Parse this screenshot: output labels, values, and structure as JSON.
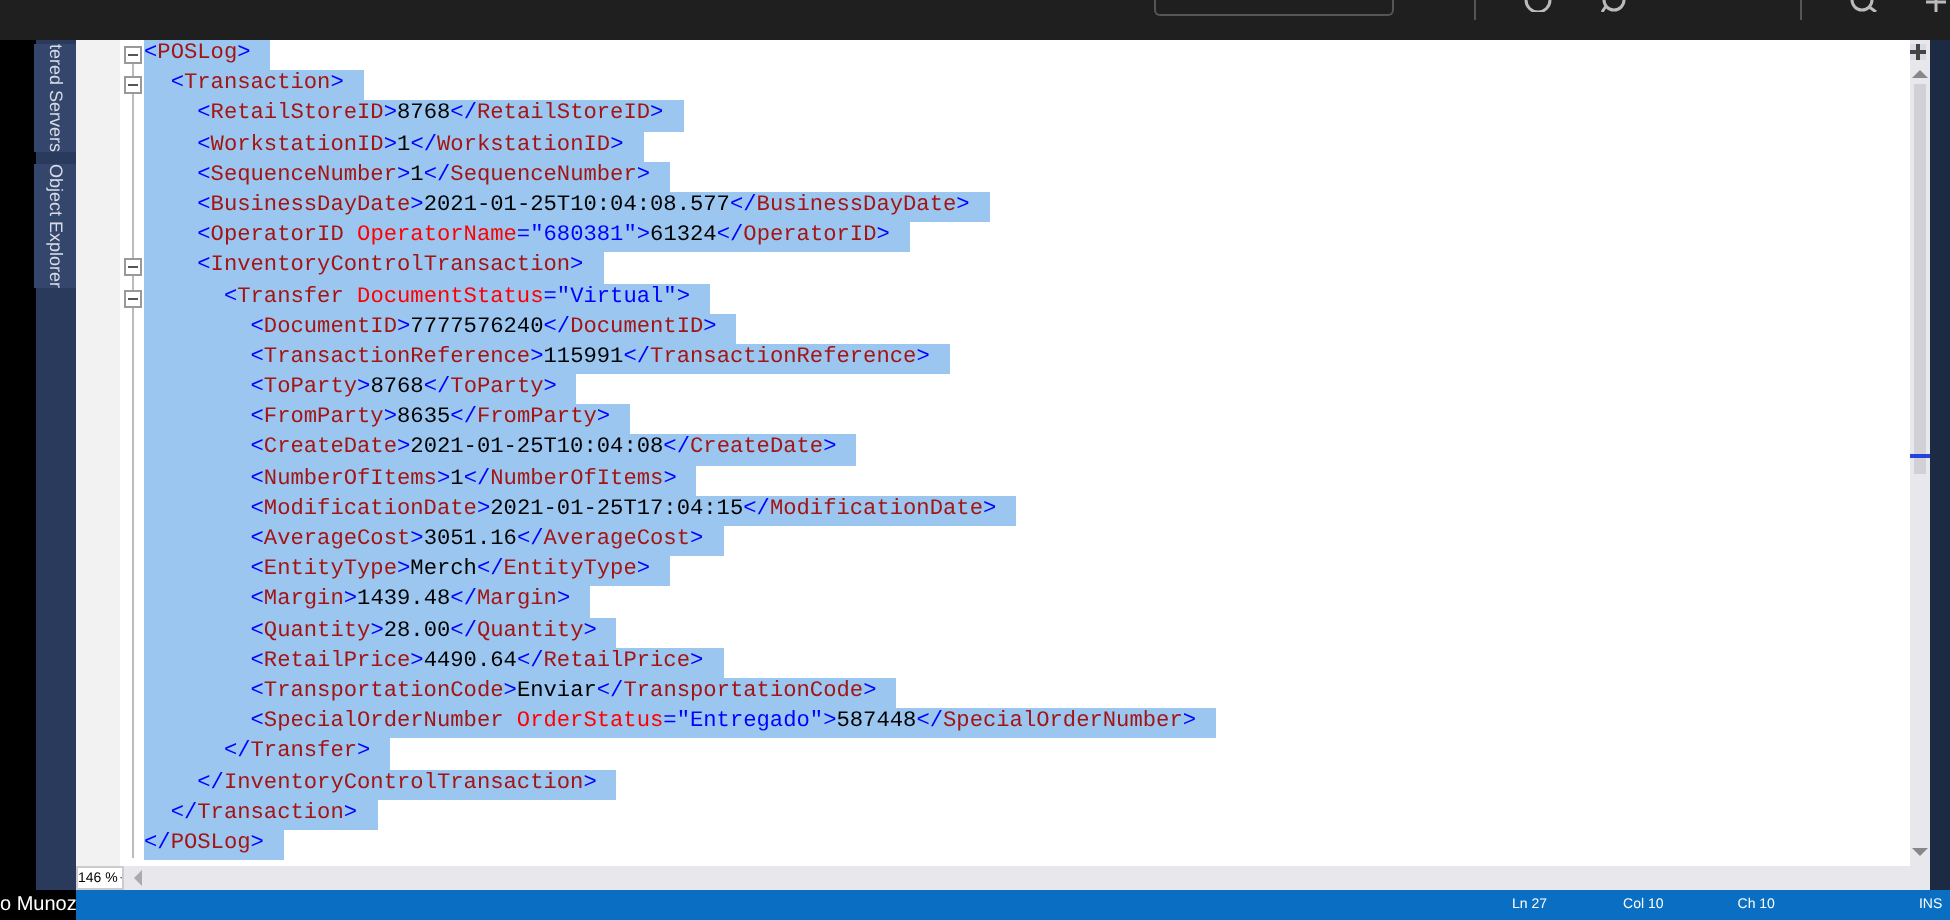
{
  "sidebar": {
    "tabs": [
      {
        "label": "tered Servers"
      },
      {
        "label": "Object Explorer"
      }
    ]
  },
  "editor": {
    "lines": [
      {
        "expanded": true,
        "selected": true,
        "tokens": [
          {
            "kind": "punct",
            "text": "<"
          },
          {
            "kind": "name",
            "text": "POSLog"
          },
          {
            "kind": "punct",
            "text": ">"
          }
        ]
      },
      {
        "expanded": true,
        "selected": true,
        "tokens": [
          {
            "kind": "punct",
            "text": "  <"
          },
          {
            "kind": "name",
            "text": "Transaction"
          },
          {
            "kind": "punct",
            "text": ">"
          }
        ]
      },
      {
        "selected": true,
        "tokens": [
          {
            "kind": "punct",
            "text": "    <"
          },
          {
            "kind": "name",
            "text": "RetailStoreID"
          },
          {
            "kind": "punct",
            "text": ">"
          },
          {
            "kind": "text",
            "text": "8768"
          },
          {
            "kind": "punct",
            "text": "</"
          },
          {
            "kind": "name",
            "text": "RetailStoreID"
          },
          {
            "kind": "punct",
            "text": ">"
          }
        ]
      },
      {
        "selected": true,
        "tokens": [
          {
            "kind": "punct",
            "text": "    <"
          },
          {
            "kind": "name",
            "text": "WorkstationID"
          },
          {
            "kind": "punct",
            "text": ">"
          },
          {
            "kind": "text",
            "text": "1"
          },
          {
            "kind": "punct",
            "text": "</"
          },
          {
            "kind": "name",
            "text": "WorkstationID"
          },
          {
            "kind": "punct",
            "text": ">"
          }
        ]
      },
      {
        "selected": true,
        "tokens": [
          {
            "kind": "punct",
            "text": "    <"
          },
          {
            "kind": "name",
            "text": "SequenceNumber"
          },
          {
            "kind": "punct",
            "text": ">"
          },
          {
            "kind": "text",
            "text": "1"
          },
          {
            "kind": "punct",
            "text": "</"
          },
          {
            "kind": "name",
            "text": "SequenceNumber"
          },
          {
            "kind": "punct",
            "text": ">"
          }
        ]
      },
      {
        "selected": true,
        "tokens": [
          {
            "kind": "punct",
            "text": "    <"
          },
          {
            "kind": "name",
            "text": "BusinessDayDate"
          },
          {
            "kind": "punct",
            "text": ">"
          },
          {
            "kind": "text",
            "text": "2021-01-25T10:04:08.577"
          },
          {
            "kind": "punct",
            "text": "</"
          },
          {
            "kind": "name",
            "text": "BusinessDayDate"
          },
          {
            "kind": "punct",
            "text": ">"
          }
        ]
      },
      {
        "selected": true,
        "tokens": [
          {
            "kind": "punct",
            "text": "    <"
          },
          {
            "kind": "name",
            "text": "OperatorID"
          },
          {
            "kind": "attr",
            "text": " OperatorName"
          },
          {
            "kind": "punct",
            "text": "="
          },
          {
            "kind": "value",
            "text": "\"680381\""
          },
          {
            "kind": "punct",
            "text": ">"
          },
          {
            "kind": "text",
            "text": "61324"
          },
          {
            "kind": "punct",
            "text": "</"
          },
          {
            "kind": "name",
            "text": "OperatorID"
          },
          {
            "kind": "punct",
            "text": ">"
          }
        ]
      },
      {
        "expanded": true,
        "selected": true,
        "tokens": [
          {
            "kind": "punct",
            "text": "    <"
          },
          {
            "kind": "name",
            "text": "InventoryControlTransaction"
          },
          {
            "kind": "punct",
            "text": ">"
          }
        ]
      },
      {
        "expanded": true,
        "selected": true,
        "tokens": [
          {
            "kind": "punct",
            "text": "      <"
          },
          {
            "kind": "name",
            "text": "Transfer"
          },
          {
            "kind": "attr",
            "text": " DocumentStatus"
          },
          {
            "kind": "punct",
            "text": "="
          },
          {
            "kind": "value",
            "text": "\"Virtual\""
          },
          {
            "kind": "punct",
            "text": ">"
          }
        ]
      },
      {
        "selected": true,
        "tokens": [
          {
            "kind": "punct",
            "text": "        <"
          },
          {
            "kind": "name",
            "text": "DocumentID"
          },
          {
            "kind": "punct",
            "text": ">"
          },
          {
            "kind": "text",
            "text": "7777576240"
          },
          {
            "kind": "punct",
            "text": "</"
          },
          {
            "kind": "name",
            "text": "DocumentID"
          },
          {
            "kind": "punct",
            "text": ">"
          }
        ]
      },
      {
        "selected": true,
        "tokens": [
          {
            "kind": "punct",
            "text": "        <"
          },
          {
            "kind": "name",
            "text": "TransactionReference"
          },
          {
            "kind": "punct",
            "text": ">"
          },
          {
            "kind": "text",
            "text": "115991"
          },
          {
            "kind": "punct",
            "text": "</"
          },
          {
            "kind": "name",
            "text": "TransactionReference"
          },
          {
            "kind": "punct",
            "text": ">"
          }
        ]
      },
      {
        "selected": true,
        "tokens": [
          {
            "kind": "punct",
            "text": "        <"
          },
          {
            "kind": "name",
            "text": "ToParty"
          },
          {
            "kind": "punct",
            "text": ">"
          },
          {
            "kind": "text",
            "text": "8768"
          },
          {
            "kind": "punct",
            "text": "</"
          },
          {
            "kind": "name",
            "text": "ToParty"
          },
          {
            "kind": "punct",
            "text": ">"
          }
        ]
      },
      {
        "selected": true,
        "tokens": [
          {
            "kind": "punct",
            "text": "        <"
          },
          {
            "kind": "name",
            "text": "FromParty"
          },
          {
            "kind": "punct",
            "text": ">"
          },
          {
            "kind": "text",
            "text": "8635"
          },
          {
            "kind": "punct",
            "text": "</"
          },
          {
            "kind": "name",
            "text": "FromParty"
          },
          {
            "kind": "punct",
            "text": ">"
          }
        ]
      },
      {
        "selected": true,
        "tokens": [
          {
            "kind": "punct",
            "text": "        <"
          },
          {
            "kind": "name",
            "text": "CreateDate"
          },
          {
            "kind": "punct",
            "text": ">"
          },
          {
            "kind": "text",
            "text": "2021-01-25T10:04:08"
          },
          {
            "kind": "punct",
            "text": "</"
          },
          {
            "kind": "name",
            "text": "CreateDate"
          },
          {
            "kind": "punct",
            "text": ">"
          }
        ]
      },
      {
        "selected": true,
        "tokens": [
          {
            "kind": "punct",
            "text": "        <"
          },
          {
            "kind": "name",
            "text": "NumberOfItems"
          },
          {
            "kind": "punct",
            "text": ">"
          },
          {
            "kind": "text",
            "text": "1"
          },
          {
            "kind": "punct",
            "text": "</"
          },
          {
            "kind": "name",
            "text": "NumberOfItems"
          },
          {
            "kind": "punct",
            "text": ">"
          }
        ]
      },
      {
        "selected": true,
        "tokens": [
          {
            "kind": "punct",
            "text": "        <"
          },
          {
            "kind": "name",
            "text": "ModificationDate"
          },
          {
            "kind": "punct",
            "text": ">"
          },
          {
            "kind": "text",
            "text": "2021-01-25T17:04:15"
          },
          {
            "kind": "punct",
            "text": "</"
          },
          {
            "kind": "name",
            "text": "ModificationDate"
          },
          {
            "kind": "punct",
            "text": ">"
          }
        ]
      },
      {
        "selected": true,
        "tokens": [
          {
            "kind": "punct",
            "text": "        <"
          },
          {
            "kind": "name",
            "text": "AverageCost"
          },
          {
            "kind": "punct",
            "text": ">"
          },
          {
            "kind": "text",
            "text": "3051.16"
          },
          {
            "kind": "punct",
            "text": "</"
          },
          {
            "kind": "name",
            "text": "AverageCost"
          },
          {
            "kind": "punct",
            "text": ">"
          }
        ]
      },
      {
        "selected": true,
        "tokens": [
          {
            "kind": "punct",
            "text": "        <"
          },
          {
            "kind": "name",
            "text": "EntityType"
          },
          {
            "kind": "punct",
            "text": ">"
          },
          {
            "kind": "text",
            "text": "Merch"
          },
          {
            "kind": "punct",
            "text": "</"
          },
          {
            "kind": "name",
            "text": "EntityType"
          },
          {
            "kind": "punct",
            "text": ">"
          }
        ]
      },
      {
        "selected": true,
        "tokens": [
          {
            "kind": "punct",
            "text": "        <"
          },
          {
            "kind": "name",
            "text": "Margin"
          },
          {
            "kind": "punct",
            "text": ">"
          },
          {
            "kind": "text",
            "text": "1439.48"
          },
          {
            "kind": "punct",
            "text": "</"
          },
          {
            "kind": "name",
            "text": "Margin"
          },
          {
            "kind": "punct",
            "text": ">"
          }
        ]
      },
      {
        "selected": true,
        "tokens": [
          {
            "kind": "punct",
            "text": "        <"
          },
          {
            "kind": "name",
            "text": "Quantity"
          },
          {
            "kind": "punct",
            "text": ">"
          },
          {
            "kind": "text",
            "text": "28.00"
          },
          {
            "kind": "punct",
            "text": "</"
          },
          {
            "kind": "name",
            "text": "Quantity"
          },
          {
            "kind": "punct",
            "text": ">"
          }
        ]
      },
      {
        "selected": true,
        "tokens": [
          {
            "kind": "punct",
            "text": "        <"
          },
          {
            "kind": "name",
            "text": "RetailPrice"
          },
          {
            "kind": "punct",
            "text": ">"
          },
          {
            "kind": "text",
            "text": "4490.64"
          },
          {
            "kind": "punct",
            "text": "</"
          },
          {
            "kind": "name",
            "text": "RetailPrice"
          },
          {
            "kind": "punct",
            "text": ">"
          }
        ]
      },
      {
        "selected": true,
        "tokens": [
          {
            "kind": "punct",
            "text": "        <"
          },
          {
            "kind": "name",
            "text": "TransportationCode"
          },
          {
            "kind": "punct",
            "text": ">"
          },
          {
            "kind": "text",
            "text": "Enviar"
          },
          {
            "kind": "punct",
            "text": "</"
          },
          {
            "kind": "name",
            "text": "TransportationCode"
          },
          {
            "kind": "punct",
            "text": ">"
          }
        ]
      },
      {
        "selected": true,
        "tokens": [
          {
            "kind": "punct",
            "text": "        <"
          },
          {
            "kind": "name",
            "text": "SpecialOrderNumber"
          },
          {
            "kind": "attr",
            "text": " OrderStatus"
          },
          {
            "kind": "punct",
            "text": "="
          },
          {
            "kind": "value",
            "text": "\"Entregado\""
          },
          {
            "kind": "punct",
            "text": ">"
          },
          {
            "kind": "text",
            "text": "587448"
          },
          {
            "kind": "punct",
            "text": "</"
          },
          {
            "kind": "name",
            "text": "SpecialOrderNumber"
          },
          {
            "kind": "punct",
            "text": ">"
          }
        ]
      },
      {
        "selected": true,
        "tokens": [
          {
            "kind": "punct",
            "text": "      </"
          },
          {
            "kind": "name",
            "text": "Transfer"
          },
          {
            "kind": "punct",
            "text": ">"
          }
        ]
      },
      {
        "selected": true,
        "tokens": [
          {
            "kind": "punct",
            "text": "    </"
          },
          {
            "kind": "name",
            "text": "InventoryControlTransaction"
          },
          {
            "kind": "punct",
            "text": ">"
          }
        ]
      },
      {
        "selected": true,
        "tokens": [
          {
            "kind": "punct",
            "text": "  </"
          },
          {
            "kind": "name",
            "text": "Transaction"
          },
          {
            "kind": "punct",
            "text": ">"
          }
        ]
      },
      {
        "selected": true,
        "tokens": [
          {
            "kind": "punct",
            "text": "</"
          },
          {
            "kind": "name",
            "text": "POSLog"
          },
          {
            "kind": "punct",
            "text": ">"
          }
        ]
      }
    ],
    "zoom": "146 %"
  },
  "participant_name": "o Munoz",
  "status_bar": {
    "items": [
      "Ln 27",
      "Col 10",
      "Ch 10",
      "INS"
    ]
  }
}
